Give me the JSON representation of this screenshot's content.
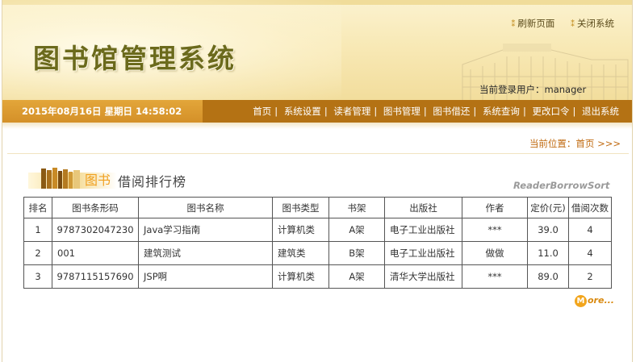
{
  "header": {
    "app_title": "图书馆管理系统",
    "refresh_label": "刷新页面",
    "close_label": "关闭系统",
    "login_user": "当前登录用户：manager"
  },
  "nav": {
    "datetime": "2015年08月16日 星期日 14:58:02",
    "items": [
      "首页",
      "系统设置",
      "读者管理",
      "图书管理",
      "图书借还",
      "系统查询",
      "更改口令",
      "退出系统"
    ]
  },
  "breadcrumb": "当前位置：首页 >>>",
  "section": {
    "icon_text": "图书",
    "title": "借阅排行榜",
    "subtitle_en": "ReaderBorrowSort"
  },
  "table": {
    "headers": [
      "排名",
      "图书条形码",
      "图书名称",
      "图书类型",
      "书架",
      "出版社",
      "作者",
      "定价(元)",
      "借阅次数"
    ],
    "rows": [
      [
        "1",
        "9787302047230",
        "Java学习指南",
        "计算机类",
        "A架",
        "电子工业出版社",
        "***",
        "39.0",
        "4"
      ],
      [
        "2",
        "001",
        "建筑测试",
        "建筑类",
        "B架",
        "电子工业出版社",
        "做做",
        "11.0",
        "4"
      ],
      [
        "3",
        "9787115157690",
        "JSP啊",
        "计算机类",
        "A架",
        "清华大学出版社",
        "***",
        "89.0",
        "2"
      ]
    ]
  },
  "more_label": "ore...",
  "more_badge": "M",
  "colors": {
    "nav_bar": "#b47214",
    "date_bar": "#d49028",
    "title_text": "#6b6a1c",
    "breadcrumb": "#c06a10"
  },
  "icons": [
    "refresh-icon",
    "close-icon",
    "building-image",
    "books-icon",
    "more-icon"
  ]
}
